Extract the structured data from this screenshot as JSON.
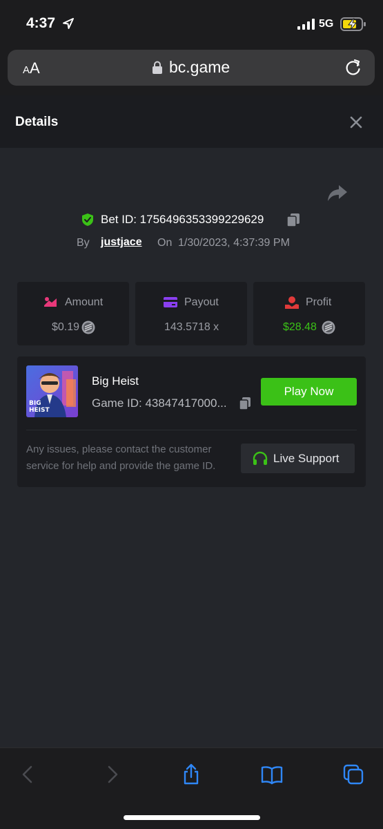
{
  "status": {
    "time": "4:37",
    "network": "5G"
  },
  "browser": {
    "text_size_small": "A",
    "text_size_large": "A",
    "url": "bc.game"
  },
  "modal": {
    "title": "Details"
  },
  "bet": {
    "id_label": "Bet ID: 1756496353399229629",
    "by_label": "By",
    "username": "justjace",
    "on_label": "On",
    "datetime": "1/30/2023, 4:37:39 PM"
  },
  "stats": {
    "amount": {
      "label": "Amount",
      "value": "$0.19"
    },
    "payout": {
      "label": "Payout",
      "value": "143.5718 x"
    },
    "profit": {
      "label": "Profit",
      "value": "$28.48"
    }
  },
  "game": {
    "name": "Big Heist",
    "id_label": "Game ID: 43847417000...",
    "thumb_text_1": "BIG",
    "thumb_text_2": "HEIST",
    "play_label": "Play Now",
    "issues_text": "Any issues, please contact the customer service for help and provide the game ID.",
    "support_label": "Live Support"
  },
  "colors": {
    "accent_green": "#3bc117",
    "profit_green": "#3bc117",
    "amount_icon": "#e8387a",
    "payout_icon": "#8a3ff0",
    "profit_icon": "#e03a3a",
    "ios_blue": "#2f87f7"
  },
  "toolbar": {
    "icons": [
      "back-icon",
      "forward-icon",
      "share-icon",
      "bookmarks-icon",
      "tabs-icon"
    ]
  }
}
